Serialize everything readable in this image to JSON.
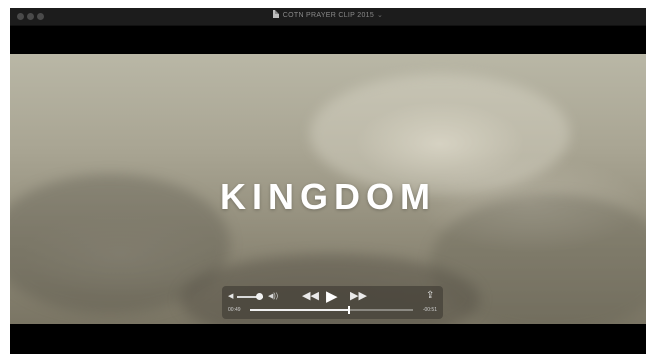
{
  "window": {
    "title": "COTN PRAYER CLIP 2015",
    "title_chevron": "⌄"
  },
  "video": {
    "overlay_text": "KINGDOM"
  },
  "controls": {
    "volume_level": 0.85,
    "elapsed": "00:49",
    "remaining": "-00:51",
    "progress": 0.61,
    "icons": {
      "volume_low": "speaker-low-icon",
      "volume_high": "speaker-high-icon",
      "rewind": "rewind-icon",
      "play": "play-icon",
      "fast_forward": "fast-forward-icon",
      "share": "share-icon"
    },
    "glyphs": {
      "volume_low": "◀",
      "volume_high": "◀))",
      "rewind": "◀◀",
      "play": "▶",
      "fast_forward": "▶▶",
      "share": "⇪"
    }
  }
}
